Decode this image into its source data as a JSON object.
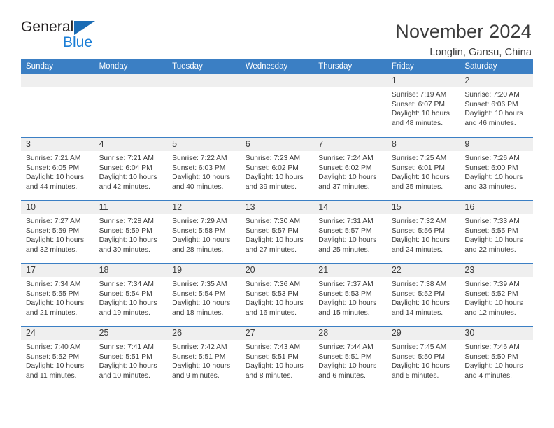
{
  "logo": {
    "text_general": "General",
    "text_blue": "Blue",
    "triangle_color": "#1b6cb5",
    "blue_color": "#1b7ed6"
  },
  "header": {
    "title": "November 2024",
    "subtitle": "Longlin, Gansu, China"
  },
  "theme": {
    "header_blue": "#3b7fc4",
    "daynum_band": "#efefef",
    "text": "#3b3b3b"
  },
  "weekday_headers": [
    "Sunday",
    "Monday",
    "Tuesday",
    "Wednesday",
    "Thursday",
    "Friday",
    "Saturday"
  ],
  "weeks": [
    [
      {
        "day": "",
        "empty": true,
        "sunrise": "",
        "sunset": "",
        "daylight1": "",
        "daylight2": ""
      },
      {
        "day": "",
        "empty": true,
        "sunrise": "",
        "sunset": "",
        "daylight1": "",
        "daylight2": ""
      },
      {
        "day": "",
        "empty": true,
        "sunrise": "",
        "sunset": "",
        "daylight1": "",
        "daylight2": ""
      },
      {
        "day": "",
        "empty": true,
        "sunrise": "",
        "sunset": "",
        "daylight1": "",
        "daylight2": ""
      },
      {
        "day": "",
        "empty": true,
        "sunrise": "",
        "sunset": "",
        "daylight1": "",
        "daylight2": ""
      },
      {
        "day": "1",
        "sunrise": "Sunrise: 7:19 AM",
        "sunset": "Sunset: 6:07 PM",
        "daylight1": "Daylight: 10 hours",
        "daylight2": "and 48 minutes."
      },
      {
        "day": "2",
        "sunrise": "Sunrise: 7:20 AM",
        "sunset": "Sunset: 6:06 PM",
        "daylight1": "Daylight: 10 hours",
        "daylight2": "and 46 minutes."
      }
    ],
    [
      {
        "day": "3",
        "sunrise": "Sunrise: 7:21 AM",
        "sunset": "Sunset: 6:05 PM",
        "daylight1": "Daylight: 10 hours",
        "daylight2": "and 44 minutes."
      },
      {
        "day": "4",
        "sunrise": "Sunrise: 7:21 AM",
        "sunset": "Sunset: 6:04 PM",
        "daylight1": "Daylight: 10 hours",
        "daylight2": "and 42 minutes."
      },
      {
        "day": "5",
        "sunrise": "Sunrise: 7:22 AM",
        "sunset": "Sunset: 6:03 PM",
        "daylight1": "Daylight: 10 hours",
        "daylight2": "and 40 minutes."
      },
      {
        "day": "6",
        "sunrise": "Sunrise: 7:23 AM",
        "sunset": "Sunset: 6:02 PM",
        "daylight1": "Daylight: 10 hours",
        "daylight2": "and 39 minutes."
      },
      {
        "day": "7",
        "sunrise": "Sunrise: 7:24 AM",
        "sunset": "Sunset: 6:02 PM",
        "daylight1": "Daylight: 10 hours",
        "daylight2": "and 37 minutes."
      },
      {
        "day": "8",
        "sunrise": "Sunrise: 7:25 AM",
        "sunset": "Sunset: 6:01 PM",
        "daylight1": "Daylight: 10 hours",
        "daylight2": "and 35 minutes."
      },
      {
        "day": "9",
        "sunrise": "Sunrise: 7:26 AM",
        "sunset": "Sunset: 6:00 PM",
        "daylight1": "Daylight: 10 hours",
        "daylight2": "and 33 minutes."
      }
    ],
    [
      {
        "day": "10",
        "sunrise": "Sunrise: 7:27 AM",
        "sunset": "Sunset: 5:59 PM",
        "daylight1": "Daylight: 10 hours",
        "daylight2": "and 32 minutes."
      },
      {
        "day": "11",
        "sunrise": "Sunrise: 7:28 AM",
        "sunset": "Sunset: 5:59 PM",
        "daylight1": "Daylight: 10 hours",
        "daylight2": "and 30 minutes."
      },
      {
        "day": "12",
        "sunrise": "Sunrise: 7:29 AM",
        "sunset": "Sunset: 5:58 PM",
        "daylight1": "Daylight: 10 hours",
        "daylight2": "and 28 minutes."
      },
      {
        "day": "13",
        "sunrise": "Sunrise: 7:30 AM",
        "sunset": "Sunset: 5:57 PM",
        "daylight1": "Daylight: 10 hours",
        "daylight2": "and 27 minutes."
      },
      {
        "day": "14",
        "sunrise": "Sunrise: 7:31 AM",
        "sunset": "Sunset: 5:57 PM",
        "daylight1": "Daylight: 10 hours",
        "daylight2": "and 25 minutes."
      },
      {
        "day": "15",
        "sunrise": "Sunrise: 7:32 AM",
        "sunset": "Sunset: 5:56 PM",
        "daylight1": "Daylight: 10 hours",
        "daylight2": "and 24 minutes."
      },
      {
        "day": "16",
        "sunrise": "Sunrise: 7:33 AM",
        "sunset": "Sunset: 5:55 PM",
        "daylight1": "Daylight: 10 hours",
        "daylight2": "and 22 minutes."
      }
    ],
    [
      {
        "day": "17",
        "sunrise": "Sunrise: 7:34 AM",
        "sunset": "Sunset: 5:55 PM",
        "daylight1": "Daylight: 10 hours",
        "daylight2": "and 21 minutes."
      },
      {
        "day": "18",
        "sunrise": "Sunrise: 7:34 AM",
        "sunset": "Sunset: 5:54 PM",
        "daylight1": "Daylight: 10 hours",
        "daylight2": "and 19 minutes."
      },
      {
        "day": "19",
        "sunrise": "Sunrise: 7:35 AM",
        "sunset": "Sunset: 5:54 PM",
        "daylight1": "Daylight: 10 hours",
        "daylight2": "and 18 minutes."
      },
      {
        "day": "20",
        "sunrise": "Sunrise: 7:36 AM",
        "sunset": "Sunset: 5:53 PM",
        "daylight1": "Daylight: 10 hours",
        "daylight2": "and 16 minutes."
      },
      {
        "day": "21",
        "sunrise": "Sunrise: 7:37 AM",
        "sunset": "Sunset: 5:53 PM",
        "daylight1": "Daylight: 10 hours",
        "daylight2": "and 15 minutes."
      },
      {
        "day": "22",
        "sunrise": "Sunrise: 7:38 AM",
        "sunset": "Sunset: 5:52 PM",
        "daylight1": "Daylight: 10 hours",
        "daylight2": "and 14 minutes."
      },
      {
        "day": "23",
        "sunrise": "Sunrise: 7:39 AM",
        "sunset": "Sunset: 5:52 PM",
        "daylight1": "Daylight: 10 hours",
        "daylight2": "and 12 minutes."
      }
    ],
    [
      {
        "day": "24",
        "sunrise": "Sunrise: 7:40 AM",
        "sunset": "Sunset: 5:52 PM",
        "daylight1": "Daylight: 10 hours",
        "daylight2": "and 11 minutes."
      },
      {
        "day": "25",
        "sunrise": "Sunrise: 7:41 AM",
        "sunset": "Sunset: 5:51 PM",
        "daylight1": "Daylight: 10 hours",
        "daylight2": "and 10 minutes."
      },
      {
        "day": "26",
        "sunrise": "Sunrise: 7:42 AM",
        "sunset": "Sunset: 5:51 PM",
        "daylight1": "Daylight: 10 hours",
        "daylight2": "and 9 minutes."
      },
      {
        "day": "27",
        "sunrise": "Sunrise: 7:43 AM",
        "sunset": "Sunset: 5:51 PM",
        "daylight1": "Daylight: 10 hours",
        "daylight2": "and 8 minutes."
      },
      {
        "day": "28",
        "sunrise": "Sunrise: 7:44 AM",
        "sunset": "Sunset: 5:51 PM",
        "daylight1": "Daylight: 10 hours",
        "daylight2": "and 6 minutes."
      },
      {
        "day": "29",
        "sunrise": "Sunrise: 7:45 AM",
        "sunset": "Sunset: 5:50 PM",
        "daylight1": "Daylight: 10 hours",
        "daylight2": "and 5 minutes."
      },
      {
        "day": "30",
        "sunrise": "Sunrise: 7:46 AM",
        "sunset": "Sunset: 5:50 PM",
        "daylight1": "Daylight: 10 hours",
        "daylight2": "and 4 minutes."
      }
    ]
  ]
}
